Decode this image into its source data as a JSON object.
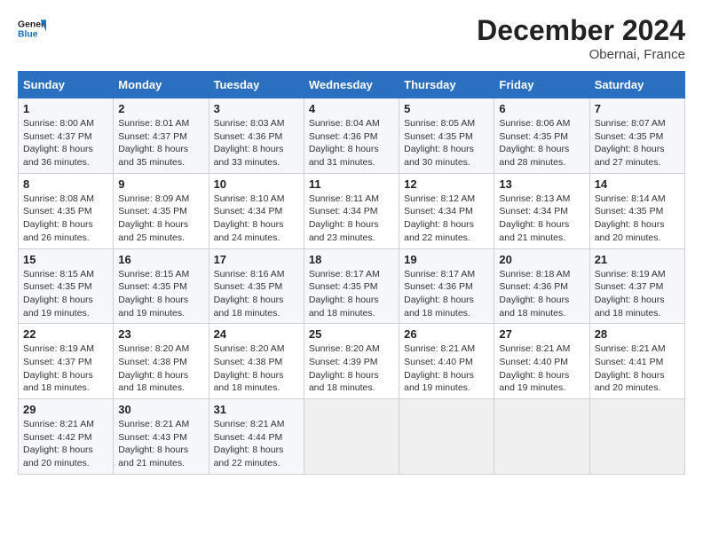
{
  "header": {
    "logo_line1": "General",
    "logo_line2": "Blue",
    "title": "December 2024",
    "subtitle": "Obernai, France"
  },
  "columns": [
    "Sunday",
    "Monday",
    "Tuesday",
    "Wednesday",
    "Thursday",
    "Friday",
    "Saturday"
  ],
  "weeks": [
    [
      {
        "day": "1",
        "sunrise": "Sunrise: 8:00 AM",
        "sunset": "Sunset: 4:37 PM",
        "daylight": "Daylight: 8 hours and 36 minutes."
      },
      {
        "day": "2",
        "sunrise": "Sunrise: 8:01 AM",
        "sunset": "Sunset: 4:37 PM",
        "daylight": "Daylight: 8 hours and 35 minutes."
      },
      {
        "day": "3",
        "sunrise": "Sunrise: 8:03 AM",
        "sunset": "Sunset: 4:36 PM",
        "daylight": "Daylight: 8 hours and 33 minutes."
      },
      {
        "day": "4",
        "sunrise": "Sunrise: 8:04 AM",
        "sunset": "Sunset: 4:36 PM",
        "daylight": "Daylight: 8 hours and 31 minutes."
      },
      {
        "day": "5",
        "sunrise": "Sunrise: 8:05 AM",
        "sunset": "Sunset: 4:35 PM",
        "daylight": "Daylight: 8 hours and 30 minutes."
      },
      {
        "day": "6",
        "sunrise": "Sunrise: 8:06 AM",
        "sunset": "Sunset: 4:35 PM",
        "daylight": "Daylight: 8 hours and 28 minutes."
      },
      {
        "day": "7",
        "sunrise": "Sunrise: 8:07 AM",
        "sunset": "Sunset: 4:35 PM",
        "daylight": "Daylight: 8 hours and 27 minutes."
      }
    ],
    [
      {
        "day": "8",
        "sunrise": "Sunrise: 8:08 AM",
        "sunset": "Sunset: 4:35 PM",
        "daylight": "Daylight: 8 hours and 26 minutes."
      },
      {
        "day": "9",
        "sunrise": "Sunrise: 8:09 AM",
        "sunset": "Sunset: 4:35 PM",
        "daylight": "Daylight: 8 hours and 25 minutes."
      },
      {
        "day": "10",
        "sunrise": "Sunrise: 8:10 AM",
        "sunset": "Sunset: 4:34 PM",
        "daylight": "Daylight: 8 hours and 24 minutes."
      },
      {
        "day": "11",
        "sunrise": "Sunrise: 8:11 AM",
        "sunset": "Sunset: 4:34 PM",
        "daylight": "Daylight: 8 hours and 23 minutes."
      },
      {
        "day": "12",
        "sunrise": "Sunrise: 8:12 AM",
        "sunset": "Sunset: 4:34 PM",
        "daylight": "Daylight: 8 hours and 22 minutes."
      },
      {
        "day": "13",
        "sunrise": "Sunrise: 8:13 AM",
        "sunset": "Sunset: 4:34 PM",
        "daylight": "Daylight: 8 hours and 21 minutes."
      },
      {
        "day": "14",
        "sunrise": "Sunrise: 8:14 AM",
        "sunset": "Sunset: 4:35 PM",
        "daylight": "Daylight: 8 hours and 20 minutes."
      }
    ],
    [
      {
        "day": "15",
        "sunrise": "Sunrise: 8:15 AM",
        "sunset": "Sunset: 4:35 PM",
        "daylight": "Daylight: 8 hours and 19 minutes."
      },
      {
        "day": "16",
        "sunrise": "Sunrise: 8:15 AM",
        "sunset": "Sunset: 4:35 PM",
        "daylight": "Daylight: 8 hours and 19 minutes."
      },
      {
        "day": "17",
        "sunrise": "Sunrise: 8:16 AM",
        "sunset": "Sunset: 4:35 PM",
        "daylight": "Daylight: 8 hours and 18 minutes."
      },
      {
        "day": "18",
        "sunrise": "Sunrise: 8:17 AM",
        "sunset": "Sunset: 4:35 PM",
        "daylight": "Daylight: 8 hours and 18 minutes."
      },
      {
        "day": "19",
        "sunrise": "Sunrise: 8:17 AM",
        "sunset": "Sunset: 4:36 PM",
        "daylight": "Daylight: 8 hours and 18 minutes."
      },
      {
        "day": "20",
        "sunrise": "Sunrise: 8:18 AM",
        "sunset": "Sunset: 4:36 PM",
        "daylight": "Daylight: 8 hours and 18 minutes."
      },
      {
        "day": "21",
        "sunrise": "Sunrise: 8:19 AM",
        "sunset": "Sunset: 4:37 PM",
        "daylight": "Daylight: 8 hours and 18 minutes."
      }
    ],
    [
      {
        "day": "22",
        "sunrise": "Sunrise: 8:19 AM",
        "sunset": "Sunset: 4:37 PM",
        "daylight": "Daylight: 8 hours and 18 minutes."
      },
      {
        "day": "23",
        "sunrise": "Sunrise: 8:20 AM",
        "sunset": "Sunset: 4:38 PM",
        "daylight": "Daylight: 8 hours and 18 minutes."
      },
      {
        "day": "24",
        "sunrise": "Sunrise: 8:20 AM",
        "sunset": "Sunset: 4:38 PM",
        "daylight": "Daylight: 8 hours and 18 minutes."
      },
      {
        "day": "25",
        "sunrise": "Sunrise: 8:20 AM",
        "sunset": "Sunset: 4:39 PM",
        "daylight": "Daylight: 8 hours and 18 minutes."
      },
      {
        "day": "26",
        "sunrise": "Sunrise: 8:21 AM",
        "sunset": "Sunset: 4:40 PM",
        "daylight": "Daylight: 8 hours and 19 minutes."
      },
      {
        "day": "27",
        "sunrise": "Sunrise: 8:21 AM",
        "sunset": "Sunset: 4:40 PM",
        "daylight": "Daylight: 8 hours and 19 minutes."
      },
      {
        "day": "28",
        "sunrise": "Sunrise: 8:21 AM",
        "sunset": "Sunset: 4:41 PM",
        "daylight": "Daylight: 8 hours and 20 minutes."
      }
    ],
    [
      {
        "day": "29",
        "sunrise": "Sunrise: 8:21 AM",
        "sunset": "Sunset: 4:42 PM",
        "daylight": "Daylight: 8 hours and 20 minutes."
      },
      {
        "day": "30",
        "sunrise": "Sunrise: 8:21 AM",
        "sunset": "Sunset: 4:43 PM",
        "daylight": "Daylight: 8 hours and 21 minutes."
      },
      {
        "day": "31",
        "sunrise": "Sunrise: 8:21 AM",
        "sunset": "Sunset: 4:44 PM",
        "daylight": "Daylight: 8 hours and 22 minutes."
      },
      null,
      null,
      null,
      null
    ]
  ]
}
